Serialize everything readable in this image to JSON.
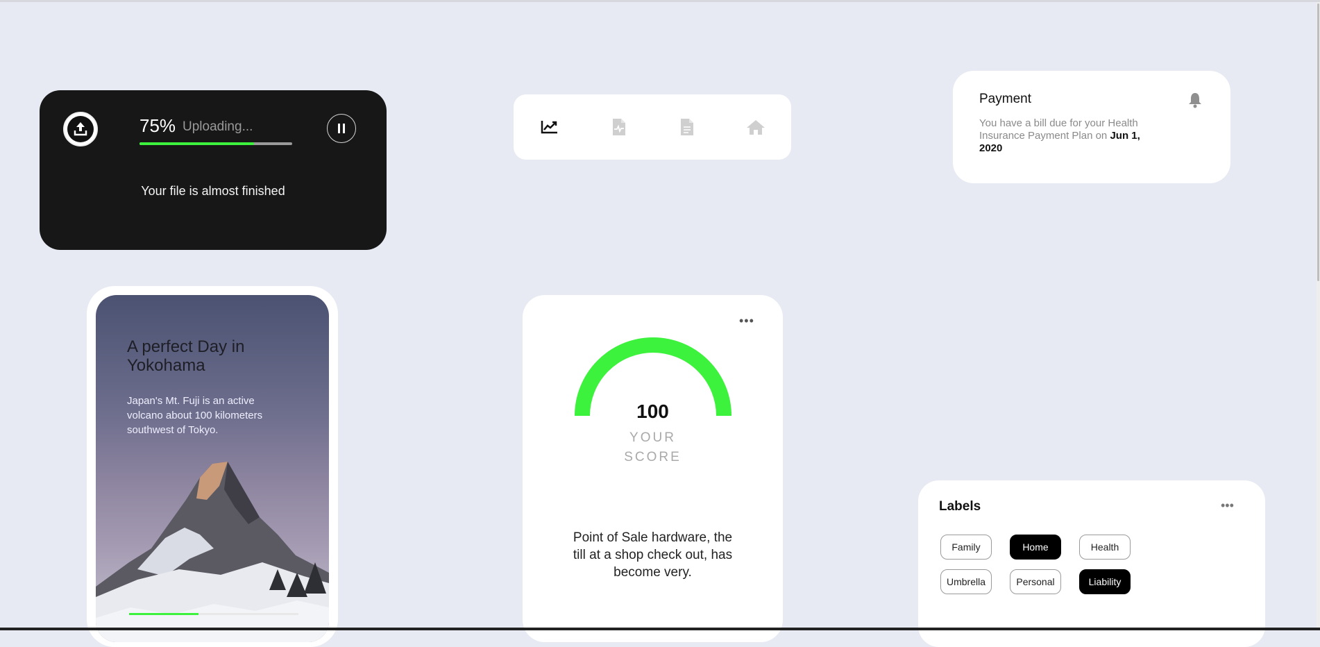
{
  "upload": {
    "percent_label": "75%",
    "percent_value": 0.75,
    "status": "Uploading...",
    "message": "Your file is almost finished",
    "icon": "upload-icon",
    "pause_icon": "pause-icon"
  },
  "nav": {
    "items": [
      {
        "icon": "chart-line-icon",
        "active": true
      },
      {
        "icon": "file-pulse-icon",
        "active": false
      },
      {
        "icon": "file-text-icon",
        "active": false
      },
      {
        "icon": "home-icon",
        "active": false
      }
    ]
  },
  "payment": {
    "title": "Payment",
    "text_lead": "You have a bill due for your Health Insurance Payment Plan on",
    "date": "Jun 1, 2020",
    "icon": "bell-icon"
  },
  "travel": {
    "title": "A perfect Day in Yokohama",
    "description": "Japan's Mt. Fuji is an active volcano about 100 kilometers southwest of Tokyo.",
    "progress": 0.41
  },
  "score": {
    "value": "100",
    "label": "YOUR SCORE",
    "description": "Point of Sale hardware, the till at a shop check out, has become very.",
    "menu": "•••",
    "gauge_fill": 1.0,
    "gauge_color": "#3cf23c"
  },
  "labels": {
    "title": "Labels",
    "menu": "•••",
    "chips": [
      {
        "label": "Family",
        "active": false
      },
      {
        "label": "Home",
        "active": true
      },
      {
        "label": "Health",
        "active": false
      },
      {
        "label": "Umbrella",
        "active": false
      },
      {
        "label": "Personal",
        "active": false
      },
      {
        "label": "Liability",
        "active": true
      }
    ]
  },
  "colors": {
    "background": "#e7eaf3",
    "accent_green": "#3cf23c",
    "dark_card": "#171717"
  }
}
